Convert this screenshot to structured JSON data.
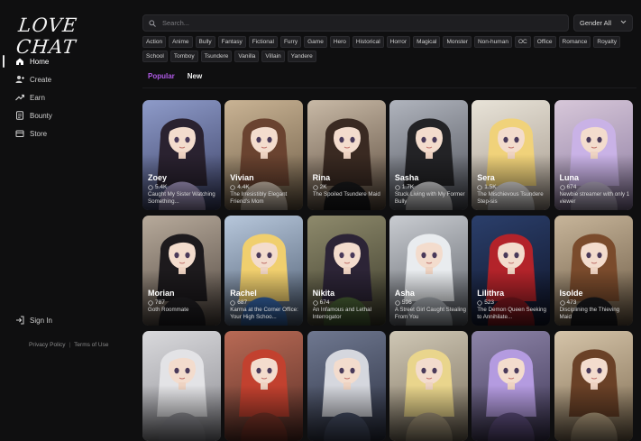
{
  "app": {
    "logo_text": "LOVE CHAT"
  },
  "sidebar": {
    "items": [
      {
        "label": "Home",
        "icon": "home-icon",
        "active": true
      },
      {
        "label": "Create",
        "icon": "add-user-icon",
        "active": false
      },
      {
        "label": "Earn",
        "icon": "trend-up-icon",
        "active": false
      },
      {
        "label": "Bounty",
        "icon": "document-icon",
        "active": false
      },
      {
        "label": "Store",
        "icon": "store-icon",
        "active": false
      }
    ],
    "signin_label": "Sign In",
    "privacy_label": "Privacy Policy",
    "terms_label": "Terms of Use",
    "separator": "|"
  },
  "search": {
    "placeholder": "Search...",
    "value": ""
  },
  "gender_filter": {
    "selected": "Gender All"
  },
  "tags": [
    "Action",
    "Anime",
    "Bully",
    "Fantasy",
    "Fictional",
    "Furry",
    "Game",
    "Hero",
    "Historical",
    "Horror",
    "Magical",
    "Monster",
    "Non-human",
    "OC",
    "Office",
    "Romance",
    "Royalty",
    "School",
    "Tomboy",
    "Tsundere",
    "Vanilla",
    "Villain",
    "Yandere"
  ],
  "tabs": {
    "popular": "Popular",
    "new": "New",
    "active": "popular"
  },
  "colors": {
    "accent": "#b05ae6",
    "background": "#0f0f10"
  },
  "cards": [
    {
      "name": "Zoey",
      "count": "5.4K",
      "desc": "Caught My Sister Watching Something...",
      "bg": [
        "#8e9bc9",
        "#3a3f64"
      ],
      "hair": "#2a2230",
      "top": "#b8a9d8"
    },
    {
      "name": "Vivian",
      "count": "4.4K",
      "desc": "The Irresistibly Elegant Friend's Mom",
      "bg": [
        "#c9b394",
        "#6b5a44"
      ],
      "hair": "#6a4330",
      "top": "#e7d6c3"
    },
    {
      "name": "Rina",
      "count": "2K",
      "desc": "The Spoiled Tsundere Maid",
      "bg": [
        "#c8b9a6",
        "#5a4a3c"
      ],
      "hair": "#3a2a22",
      "top": "#1c1c1e"
    },
    {
      "name": "Sasha",
      "count": "1.7K",
      "desc": "Stuck Living with My Former Bully",
      "bg": [
        "#b0b4bd",
        "#4c4f57"
      ],
      "hair": "#232326",
      "top": "#e8e8ea"
    },
    {
      "name": "Sera",
      "count": "1.5K",
      "desc": "The Mischievous Tsundere Step-sis",
      "bg": [
        "#e8e3d8",
        "#a3978a"
      ],
      "hair": "#f0d27a",
      "top": "#f4f0ee"
    },
    {
      "name": "Luna",
      "count": "674",
      "desc": "Newbie streamer with only 1 viewer",
      "bg": [
        "#d7c7d9",
        "#8b7aa0"
      ],
      "hair": "#c9b2e6",
      "top": "#cfc3de"
    },
    {
      "name": "Morian",
      "count": "787",
      "desc": "Goth Roommate",
      "bg": [
        "#b7aa9b",
        "#514740"
      ],
      "hair": "#1d1a1d",
      "top": "#242226"
    },
    {
      "name": "Rachel",
      "count": "687",
      "desc": "Karma at the Corner Office: Your High Schoo...",
      "bg": [
        "#b7c7db",
        "#4c5b70"
      ],
      "hair": "#f0cf6e",
      "top": "#3a6fb8"
    },
    {
      "name": "Nikita",
      "count": "674",
      "desc": "An Infamous and Lethal Interrogator",
      "bg": [
        "#8e8a6c",
        "#3b3a2a"
      ],
      "hair": "#2c2436",
      "top": "#4f6a3a"
    },
    {
      "name": "Asha",
      "count": "596",
      "desc": "A Street Girl Caught Stealing From You",
      "bg": [
        "#c9ccd1",
        "#5b5f66"
      ],
      "hair": "#e9ecef",
      "top": "#b9bfc6"
    },
    {
      "name": "Lilithra",
      "count": "523",
      "desc": "The Demon Queen Seeking to Annihilate...",
      "bg": [
        "#2b3f6b",
        "#0f1428"
      ],
      "hair": "#b3232a",
      "top": "#8f1a22"
    },
    {
      "name": "Isolde",
      "count": "473",
      "desc": "Disciplining the Thieving Maid",
      "bg": [
        "#c7b59a",
        "#6a5843"
      ],
      "hair": "#7a4b2c",
      "top": "#1e1e22"
    },
    {
      "name": "",
      "count": "",
      "desc": "",
      "bg": [
        "#d9d9dc",
        "#8c8c92"
      ],
      "hair": "#e3e3e6",
      "top": "#a0a0a6"
    },
    {
      "name": "",
      "count": "",
      "desc": "",
      "bg": [
        "#b86a55",
        "#5a2f27"
      ],
      "hair": "#c2412f",
      "top": "#8a3a2c"
    },
    {
      "name": "",
      "count": "",
      "desc": "",
      "bg": [
        "#6f7890",
        "#2c3142"
      ],
      "hair": "#d5d7de",
      "top": "#4d5670"
    },
    {
      "name": "",
      "count": "",
      "desc": "",
      "bg": [
        "#cfc7b5",
        "#7a6f5c"
      ],
      "hair": "#e9d58c",
      "top": "#b9a98a"
    },
    {
      "name": "",
      "count": "",
      "desc": "",
      "bg": [
        "#8d84a8",
        "#3f3756"
      ],
      "hair": "#b49be0",
      "top": "#6d5a92"
    },
    {
      "name": "",
      "count": "",
      "desc": "",
      "bg": [
        "#d5c4a9",
        "#7d6a50"
      ],
      "hair": "#6a4127",
      "top": "#c9b28e"
    }
  ]
}
